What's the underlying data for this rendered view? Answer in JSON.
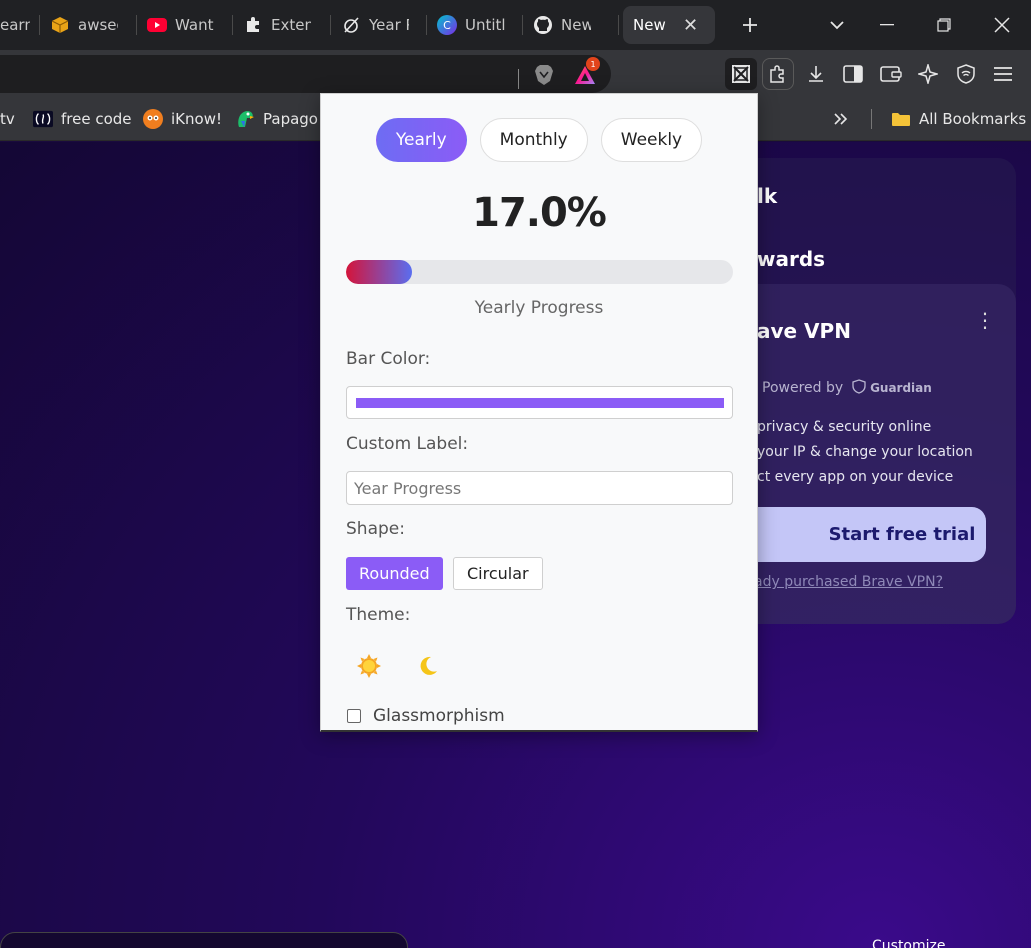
{
  "tabs": [
    {
      "label": "earn",
      "icon": "partial-tab-icon"
    },
    {
      "label": "awsed",
      "icon": "aws-box-icon"
    },
    {
      "label": "Want",
      "icon": "youtube-icon"
    },
    {
      "label": "Exten",
      "icon": "puzzle-icon"
    },
    {
      "label": "Year P",
      "icon": "year-progress-icon"
    },
    {
      "label": "Untitl",
      "icon": "canva-icon"
    },
    {
      "label": "New",
      "icon": "github-icon"
    },
    {
      "label": "New",
      "icon": "none",
      "active": true
    }
  ],
  "bookmarks": [
    {
      "label": "tv"
    },
    {
      "label": "free code"
    },
    {
      "label": "iKnow!"
    },
    {
      "label": "Papago"
    }
  ],
  "all_bookmarks_label": "All Bookmarks",
  "rewards_badge": "1",
  "ntp": {
    "talk_partial": "lk",
    "rewards_partial": "wards",
    "vpn_title_partial": "ave VPN",
    "powered_by": "Powered by",
    "guardian": "Guardian",
    "features": [
      "privacy & security online",
      "your IP & change your location",
      "ct every app on your device"
    ],
    "trial_button": "Start free trial",
    "purchased_link": "ady purchased Brave VPN?",
    "customize": "Customize"
  },
  "popup": {
    "periods": [
      "Yearly",
      "Monthly",
      "Weekly"
    ],
    "selected_period": "Yearly",
    "percent_text": "17.0%",
    "progress_fraction": 0.17,
    "bar_caption": "Yearly Progress",
    "bar_color_label": "Bar Color:",
    "bar_color": "#8b5cf6",
    "custom_label_label": "Custom Label:",
    "custom_label_placeholder": "Year Progress",
    "shape_label": "Shape:",
    "shapes": [
      "Rounded",
      "Circular"
    ],
    "selected_shape": "Rounded",
    "theme_label": "Theme:",
    "glass_label": "Glassmorphism"
  }
}
